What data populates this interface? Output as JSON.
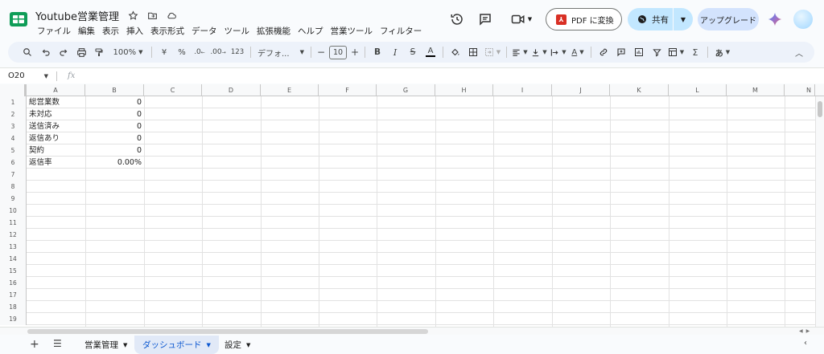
{
  "titlebar": {
    "doc_title": "Youtube営業管理",
    "menus": [
      "ファイル",
      "編集",
      "表示",
      "挿入",
      "表示形式",
      "データ",
      "ツール",
      "拡張機能",
      "ヘルプ",
      "営業ツール",
      "フィルター"
    ],
    "pdf_button": "PDF に変換",
    "share_button": "共有",
    "upgrade_button": "アップグレード"
  },
  "toolbar": {
    "zoom": "100%",
    "currency": "¥",
    "percent": "%",
    "dec_decrease": ".0",
    "dec_increase": ".00",
    "number_format": "123",
    "font": "デフォ...",
    "font_size": "10",
    "bold": "B",
    "italic": "I",
    "strike": "S",
    "text_color": "A",
    "ime": "あ"
  },
  "formula_bar": {
    "cell_ref": "O20",
    "fx": "fx"
  },
  "columns": [
    "A",
    "B",
    "C",
    "D",
    "E",
    "F",
    "G",
    "H",
    "I",
    "J",
    "K",
    "L",
    "M",
    "N"
  ],
  "rows": [
    {
      "num": "1",
      "a": "総営業数",
      "b": "0"
    },
    {
      "num": "2",
      "a": "未対応",
      "b": "0"
    },
    {
      "num": "3",
      "a": "送信済み",
      "b": "0"
    },
    {
      "num": "4",
      "a": "返信あり",
      "b": "0"
    },
    {
      "num": "5",
      "a": "契約",
      "b": "0"
    },
    {
      "num": "6",
      "a": "返信率",
      "b": "0.00%"
    },
    {
      "num": "7",
      "a": "",
      "b": ""
    },
    {
      "num": "8",
      "a": "",
      "b": ""
    },
    {
      "num": "9",
      "a": "",
      "b": ""
    },
    {
      "num": "10",
      "a": "",
      "b": ""
    },
    {
      "num": "11",
      "a": "",
      "b": ""
    },
    {
      "num": "12",
      "a": "",
      "b": ""
    },
    {
      "num": "13",
      "a": "",
      "b": ""
    },
    {
      "num": "14",
      "a": "",
      "b": ""
    },
    {
      "num": "15",
      "a": "",
      "b": ""
    },
    {
      "num": "16",
      "a": "",
      "b": ""
    },
    {
      "num": "17",
      "a": "",
      "b": ""
    },
    {
      "num": "18",
      "a": "",
      "b": ""
    },
    {
      "num": "19",
      "a": "",
      "b": ""
    }
  ],
  "sheets": {
    "tabs": [
      "営業管理",
      "ダッシュボード",
      "設定"
    ],
    "active": "ダッシュボード"
  },
  "colors": {
    "accent": "#0b57d0",
    "share_bg": "#c2e7ff",
    "upgrade_bg": "#d3e3fd",
    "sheets_green": "#0f9d58"
  }
}
